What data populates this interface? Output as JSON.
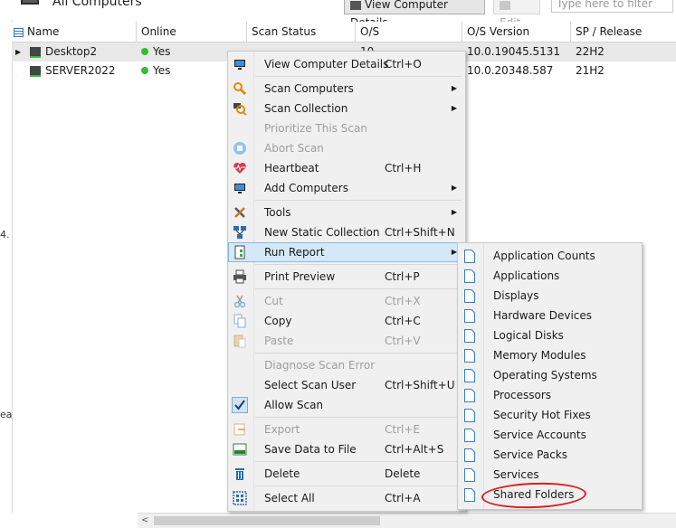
{
  "window": {
    "title": "All Computers"
  },
  "toolbar": {
    "view_details": "View Computer Details",
    "edit": "Edit",
    "filter_placeholder": "Type here to filter"
  },
  "left_strip": {
    "char1": "4.",
    "char2": "ea"
  },
  "grid": {
    "columns": [
      "Name",
      "Online",
      "Scan Status",
      "O/S",
      "O/S Version",
      "SP / Release"
    ],
    "rows": [
      {
        "name": "Desktop2",
        "online": "Yes",
        "scan_status": "",
        "os": "10",
        "os_version": "10.0.19045.5131",
        "sp_release": "22H2"
      },
      {
        "name": "SERVER2022",
        "online": "Yes",
        "scan_status": "",
        "os": "",
        "os_version": "10.0.20348.587",
        "sp_release": "21H2"
      }
    ]
  },
  "context_menu": {
    "items": [
      {
        "label": "View Computer Details",
        "shortcut": "Ctrl+O",
        "icon": "monitor-icon"
      },
      {
        "label": "Scan Computers",
        "shortcut": "",
        "icon": "magnifier-icon"
      },
      {
        "label": "Scan Collection",
        "shortcut": "",
        "icon": "scan-collection-icon"
      },
      {
        "label": "Prioritize This Scan",
        "shortcut": "",
        "icon": ""
      },
      {
        "label": "Abort Scan",
        "shortcut": "",
        "icon": "abort-icon"
      },
      {
        "label": "Heartbeat",
        "shortcut": "Ctrl+H",
        "icon": "heart-icon"
      },
      {
        "label": "Add Computers",
        "shortcut": "",
        "icon": "add-computer-icon"
      },
      {
        "label": "Tools",
        "shortcut": "",
        "icon": "tools-icon"
      },
      {
        "label": "New Static Collection",
        "shortcut": "Ctrl+Shift+N",
        "icon": "network-icon"
      },
      {
        "label": "Run Report",
        "shortcut": "",
        "icon": "report-icon"
      },
      {
        "label": "Print Preview",
        "shortcut": "Ctrl+P",
        "icon": "printer-icon"
      },
      {
        "label": "Cut",
        "shortcut": "Ctrl+X",
        "icon": "scissors-icon"
      },
      {
        "label": "Copy",
        "shortcut": "Ctrl+C",
        "icon": "copy-icon"
      },
      {
        "label": "Paste",
        "shortcut": "Ctrl+V",
        "icon": "paste-icon"
      },
      {
        "label": "Diagnose Scan Error",
        "shortcut": "",
        "icon": ""
      },
      {
        "label": "Select Scan User",
        "shortcut": "Ctrl+Shift+U",
        "icon": ""
      },
      {
        "label": "Allow Scan",
        "shortcut": "",
        "icon": "checkbox-icon"
      },
      {
        "label": "Export",
        "shortcut": "Ctrl+E",
        "icon": "export-icon"
      },
      {
        "label": "Save Data to File",
        "shortcut": "Ctrl+Alt+S",
        "icon": "csv-icon"
      },
      {
        "label": "Delete",
        "shortcut": "Delete",
        "icon": "trash-icon"
      },
      {
        "label": "Select All",
        "shortcut": "Ctrl+A",
        "icon": "select-all-icon"
      }
    ]
  },
  "report_submenu": {
    "items": [
      "Application Counts",
      "Applications",
      "Displays",
      "Hardware Devices",
      "Logical Disks",
      "Memory Modules",
      "Operating Systems",
      "Processors",
      "Security Hot Fixes",
      "Service Accounts",
      "Service Packs",
      "Services",
      "Shared Folders"
    ]
  },
  "colors": {
    "accent": "#2f6fb3",
    "highlight": "#d5e8f8",
    "annotation": "#d71f1f",
    "online": "#2fc02f"
  }
}
